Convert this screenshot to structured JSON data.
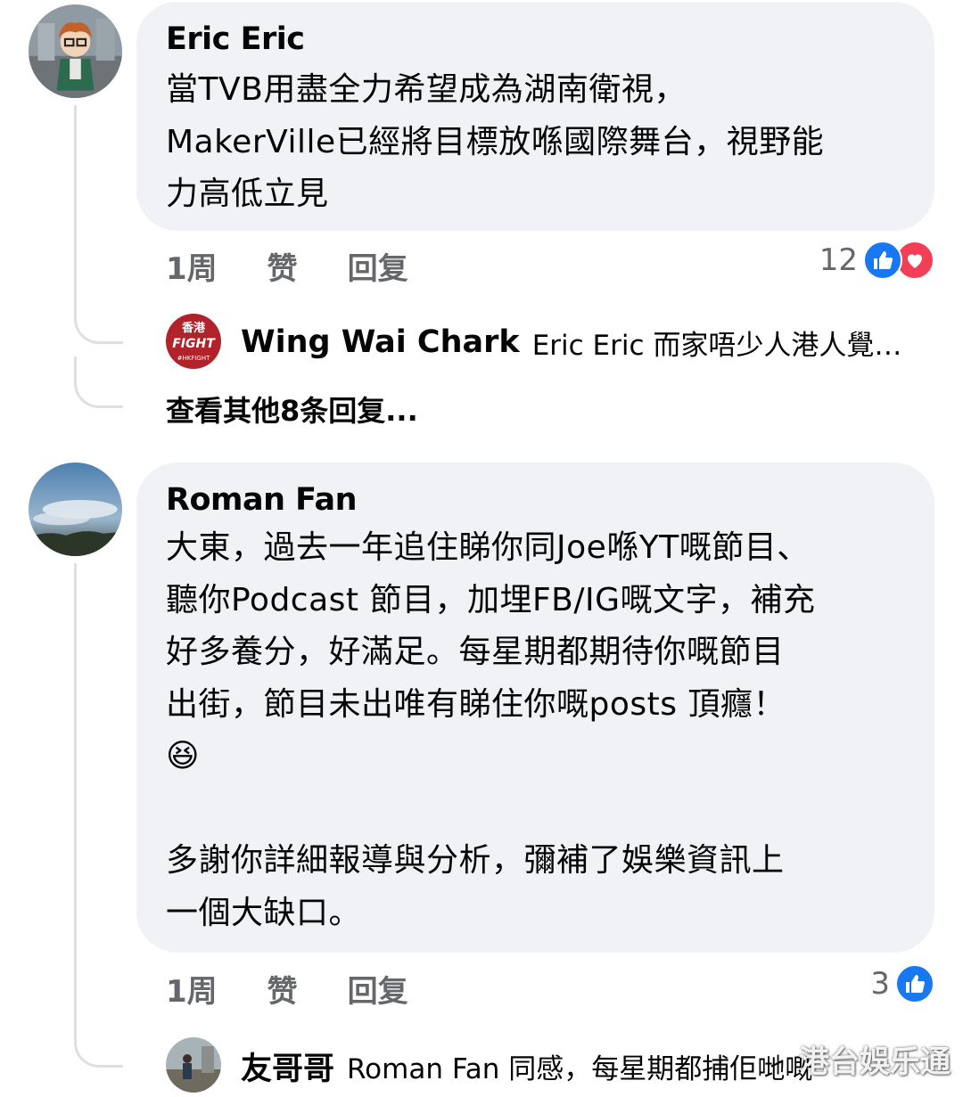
{
  "comments": [
    {
      "author": "Eric Eric",
      "text": "當TVB用盡全力希望成為湖南衛視，\nMakerVille已經將目標放喺國際舞台，視野能\n力高低立見",
      "time": "1周",
      "like_label": "赞",
      "reply_label": "回复",
      "reaction_count": "12",
      "reactions": [
        "like-icon",
        "love-icon"
      ],
      "reply_preview": {
        "author": "Wing Wai Chark",
        "text": "Eric Eric 而家唔少人港人覺…",
        "avatar_text": [
          "香港",
          "FIGHT",
          "#HKFIGHT"
        ]
      },
      "more_replies": "查看其他8条回复..."
    },
    {
      "author": "Roman Fan",
      "text": "大東，過去一年追住睇你同Joe喺YT嘅節目、\n聽你Podcast 節目，加埋FB/IG嘅文字，補充\n好多養分，好滿足。每星期都期待你嘅節目\n出街，節目未出唯有睇住你嘅posts 頂癮！\n😆\n\n多謝你詳細報導與分析，彌補了娛樂資訊上\n一個大缺口。",
      "time": "1周",
      "like_label": "赞",
      "reply_label": "回复",
      "reaction_count": "3",
      "reactions": [
        "like-icon"
      ],
      "reply_preview": {
        "author": "友哥哥",
        "text": "Roman Fan 同感，每星期都捕佢哋嘅"
      }
    }
  ],
  "watermark": "港台娛乐通",
  "colors": {
    "bubble": "#f0f2f5",
    "secondary_text": "#65676b",
    "like": "#1877f2",
    "love": "#f33e58",
    "thread_line": "#dcdfe3"
  }
}
